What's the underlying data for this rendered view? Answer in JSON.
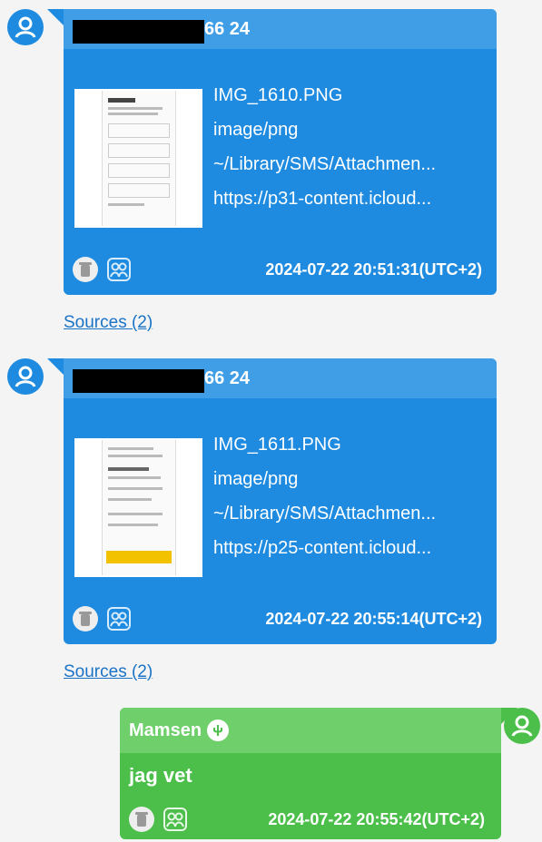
{
  "messages": [
    {
      "sender_suffix": "66 24",
      "attachment": {
        "filename": "IMG_1610.PNG",
        "mime": "image/png",
        "path": "~/Library/SMS/Attachmen...",
        "url": "https://p31-content.icloud..."
      },
      "timestamp": "2024-07-22 20:51:31(UTC+2)",
      "sources_label": "Sources (2)"
    },
    {
      "sender_suffix": "66 24",
      "attachment": {
        "filename": "IMG_1611.PNG",
        "mime": "image/png",
        "path": "~/Library/SMS/Attachmen...",
        "url": "https://p25-content.icloud..."
      },
      "timestamp": "2024-07-22 20:55:14(UTC+2)",
      "sources_label": "Sources (2)"
    },
    {
      "sender": "Mamsen",
      "text": "jag vet",
      "timestamp": "2024-07-22 20:55:42(UTC+2)"
    }
  ],
  "icons": [
    "user-avatar-icon",
    "trash-icon",
    "contact-icon",
    "whatsapp-badge-icon"
  ],
  "colors": {
    "incoming": "#1e8be0",
    "outgoing": "#4cbf4a",
    "link": "#1a73c7"
  }
}
